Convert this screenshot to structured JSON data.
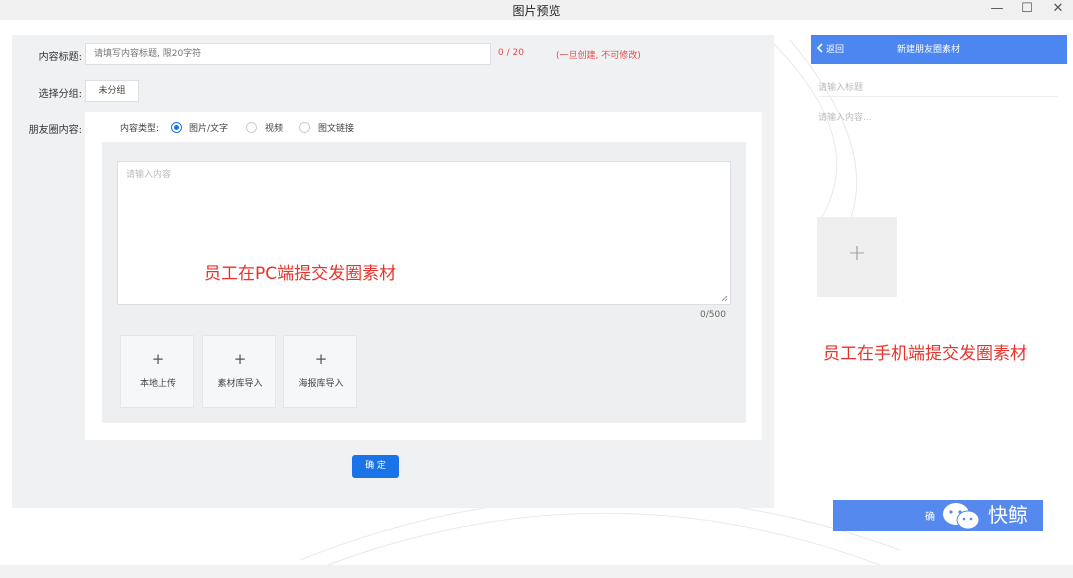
{
  "window": {
    "title": "图片预览"
  },
  "pc": {
    "title_label": "内容标题:",
    "title_placeholder": "请填写内容标题, 限20字符",
    "title_counter": "0 / 20",
    "title_note": "(一旦创建, 不可修改)",
    "group_label": "选择分组:",
    "group_value": "未分组",
    "moments_label": "朋友圈内容:",
    "content_type_label": "内容类型:",
    "content_types": [
      "图片/文字",
      "视频",
      "图文链接"
    ],
    "content_placeholder": "请输入内容",
    "char_count": "0/500",
    "upload_options": [
      {
        "label": "本地上传",
        "plus": "+"
      },
      {
        "label": "素材库导入",
        "plus": "+"
      },
      {
        "label": "海报库导入",
        "plus": "+"
      }
    ],
    "confirm": "确 定",
    "overlay": "员工在PC端提交发圈素材"
  },
  "mobile": {
    "back": "返回",
    "title": "新建朋友圈素材",
    "title_placeholder": "请输入标题",
    "content_placeholder": "请输入内容...",
    "upload_plus": "+",
    "overlay": "员工在手机端提交发圈素材",
    "confirm_partial": "确",
    "logo_text": "快鲸"
  },
  "colors": {
    "accent": "#1a73e8",
    "mobile_header": "#4c86f0",
    "annotation_red": "#e8332b"
  }
}
